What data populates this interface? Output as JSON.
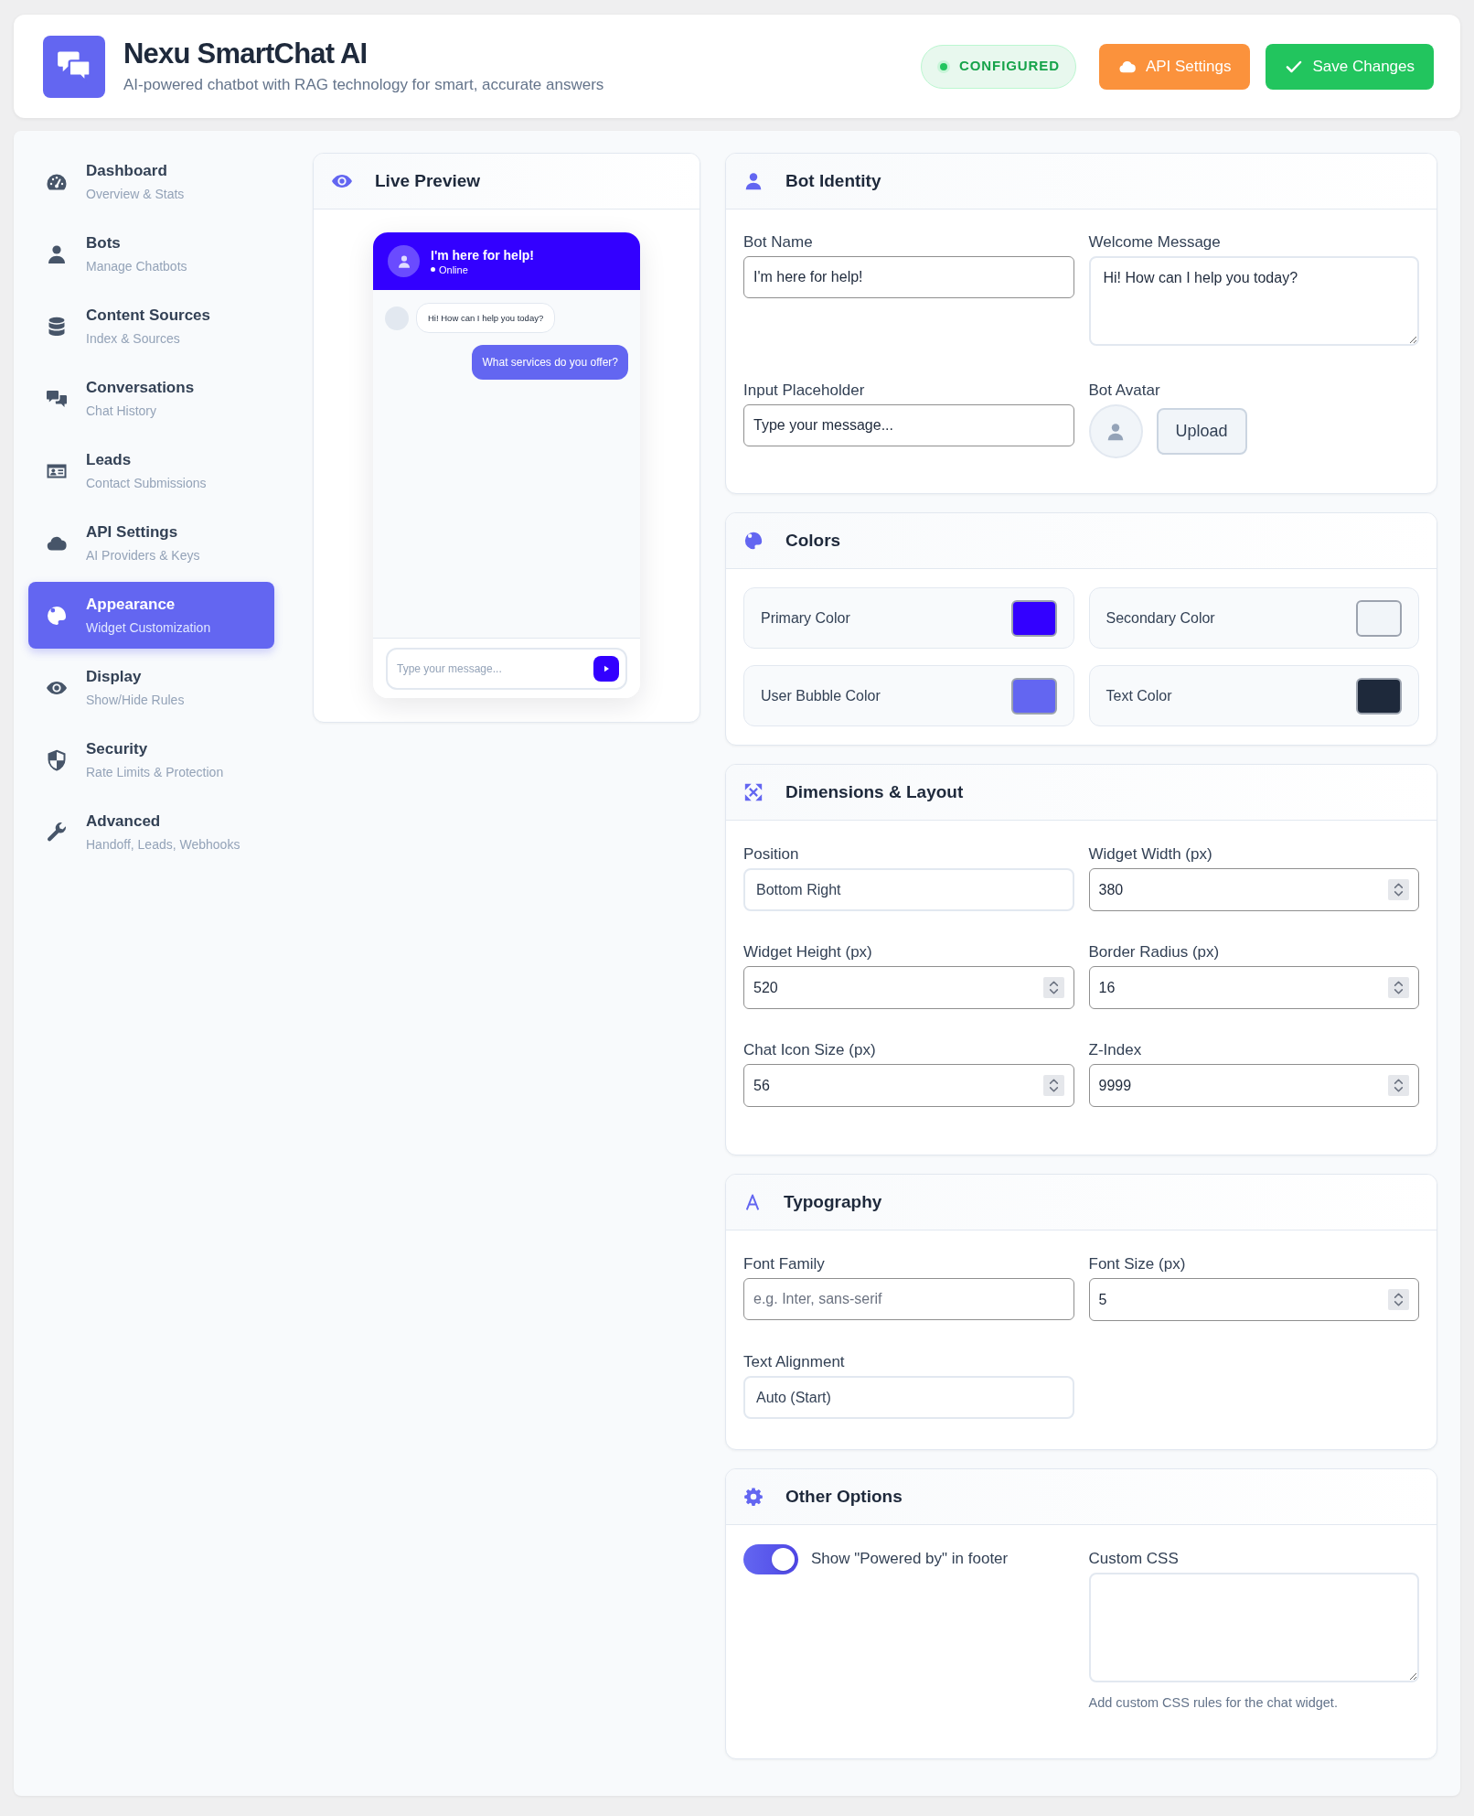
{
  "header": {
    "title": "Nexu SmartChat AI",
    "subtitle": "AI-powered chatbot with RAG technology for smart, accurate answers",
    "status": "CONFIGURED",
    "buttons": [
      {
        "label": "API Settings",
        "kind": "settings"
      },
      {
        "label": "Save Changes",
        "kind": "save"
      }
    ]
  },
  "sidebar": {
    "items": [
      {
        "title": "Dashboard",
        "subtitle": "Overview & Stats",
        "selected": false
      },
      {
        "title": "Bots",
        "subtitle": "Manage Chatbots",
        "selected": false
      },
      {
        "title": "Content Sources",
        "subtitle": "Index & Sources",
        "selected": false
      },
      {
        "title": "Conversations",
        "subtitle": "Chat History",
        "selected": false
      },
      {
        "title": "Leads",
        "subtitle": "Contact Submissions",
        "selected": false
      },
      {
        "title": "API Settings",
        "subtitle": "AI Providers & Keys",
        "selected": false
      },
      {
        "title": "Appearance",
        "subtitle": "Widget Customization",
        "selected": true
      },
      {
        "title": "Display",
        "subtitle": "Show/Hide Rules",
        "selected": false
      },
      {
        "title": "Security",
        "subtitle": "Rate Limits & Protection",
        "selected": false
      },
      {
        "title": "Advanced",
        "subtitle": "Handoff, Leads, Webhooks",
        "selected": false
      }
    ]
  },
  "live_preview": {
    "title": "Live Preview",
    "widget": {
      "bot_name": "I'm here for help!",
      "status": "Online",
      "messages": [
        {
          "kind": "bot",
          "text": "Hi! How can I help you today?"
        },
        {
          "kind": "user",
          "text": "What services do you offer?"
        }
      ],
      "input_placeholder": "Type your message..."
    }
  },
  "bot_identity": {
    "title": "Bot Identity",
    "fields": [
      {
        "label": "Bot Name",
        "kind": "text",
        "value": "I'm here for help!"
      },
      {
        "label": "Welcome Message",
        "kind": "textarea",
        "value": "Hi! How can I help you today?"
      },
      {
        "label": "Input Placeholder",
        "kind": "text",
        "value": "Type your message..."
      },
      {
        "label": "Bot Avatar",
        "kind": "avatar",
        "button": "Upload"
      }
    ]
  },
  "colors": {
    "title": "Colors",
    "items": [
      {
        "label": "Primary Color",
        "color": "#3300ff"
      },
      {
        "label": "Secondary Color",
        "color": "#f1f5f9"
      },
      {
        "label": "User Bubble Color",
        "color": "#6366f1"
      },
      {
        "label": "Text Color",
        "color": "#1e293b"
      }
    ]
  },
  "dimensions": {
    "title": "Dimensions & Layout",
    "fields": [
      {
        "label": "Position",
        "kind": "select",
        "value": "Bottom Right"
      },
      {
        "label": "Widget Width (px)",
        "kind": "number",
        "value": "380"
      },
      {
        "label": "Widget Height (px)",
        "kind": "number",
        "value": "520"
      },
      {
        "label": "Border Radius (px)",
        "kind": "number",
        "value": "16"
      },
      {
        "label": "Chat Icon Size (px)",
        "kind": "number",
        "value": "56"
      },
      {
        "label": "Z-Index",
        "kind": "number",
        "value": "9999"
      }
    ]
  },
  "typography": {
    "title": "Typography",
    "fields": [
      {
        "label": "Font Family",
        "kind": "text",
        "placeholder": "e.g. Inter, sans-serif"
      },
      {
        "label": "Font Size (px)",
        "kind": "number",
        "value": "5"
      },
      {
        "label": "Text Alignment",
        "kind": "select",
        "value": "Auto (Start)"
      }
    ]
  },
  "other_options": {
    "title": "Other Options",
    "toggle": {
      "label": "Show \"Powered by\" in footer",
      "on": true
    },
    "custom_css": {
      "label": "Custom CSS",
      "hint": "Add custom CSS rules for the chat widget."
    }
  }
}
